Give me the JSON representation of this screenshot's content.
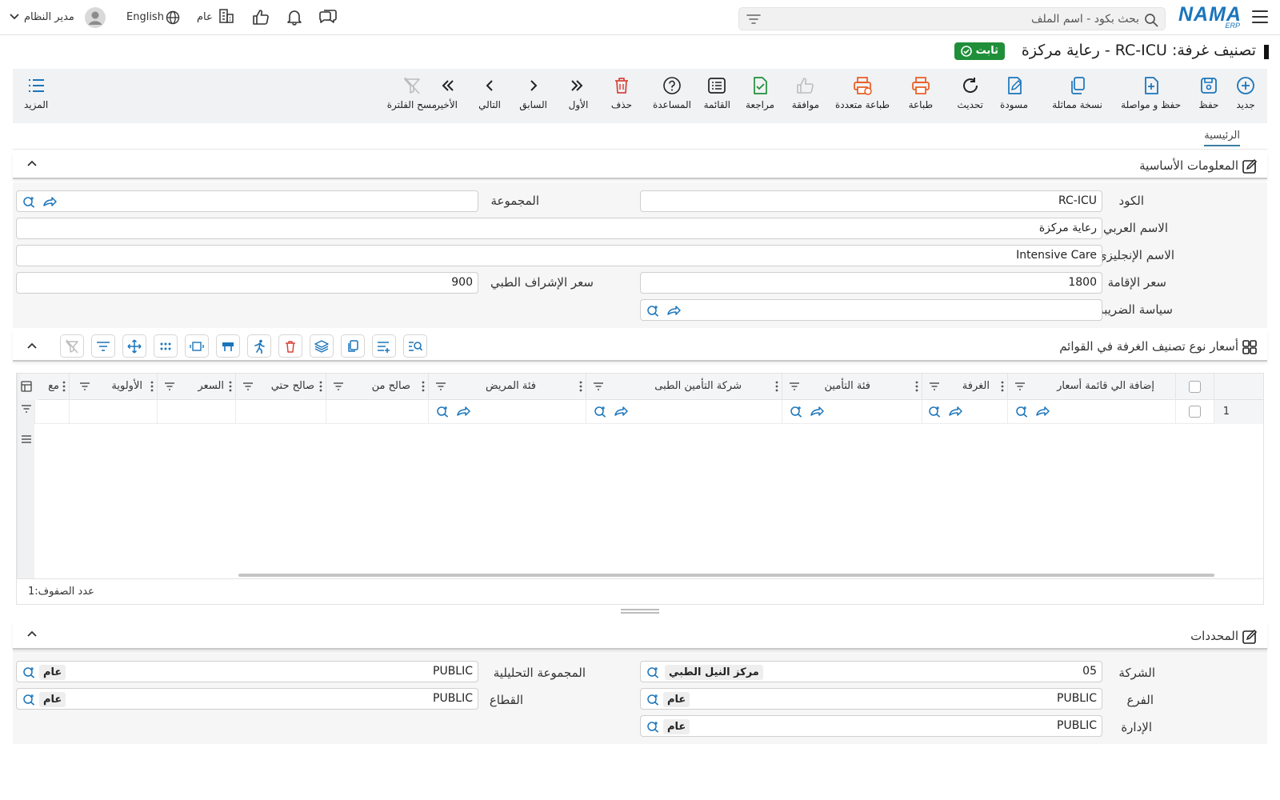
{
  "topbar": {
    "logo_main": "NAMA",
    "logo_sub": "ERP",
    "search_placeholder": "بحث بكود - اسم الملف",
    "org_label": "عام",
    "language_label": "English",
    "user_label": "مدير النظام"
  },
  "page": {
    "title": "تصنيف غرفة: RC-ICU - رعاية مركزة",
    "status_badge": "ثابت",
    "status_color": "#1f8f3a"
  },
  "toolbar": {
    "items": [
      {
        "label": "جديد",
        "icon": "plus-circle-icon"
      },
      {
        "label": "حفظ",
        "icon": "save-icon"
      },
      {
        "label": "حفظ و مواصلة",
        "icon": "save-continue-icon"
      },
      {
        "label": "نسخة مماثلة",
        "icon": "duplicate-icon"
      },
      {
        "label": "مسودة",
        "icon": "draft-icon"
      },
      {
        "label": "تحديث",
        "icon": "refresh-icon"
      },
      {
        "label": "طباعة",
        "icon": "print-icon"
      },
      {
        "label": "طباعة متعددة",
        "icon": "multi-print-icon"
      },
      {
        "label": "موافقة",
        "icon": "thumbs-up-icon"
      },
      {
        "label": "مراجعة",
        "icon": "review-icon"
      },
      {
        "label": "القائمة",
        "icon": "list-icon"
      },
      {
        "label": "المساعدة",
        "icon": "help-icon"
      },
      {
        "label": "حذف",
        "icon": "trash-icon"
      },
      {
        "label": "الأول",
        "icon": "first-icon"
      },
      {
        "label": "السابق",
        "icon": "previous-icon"
      },
      {
        "label": "التالي",
        "icon": "next-icon"
      },
      {
        "label": "الأخير",
        "icon": "last-icon"
      },
      {
        "label": "مسح الفلترة",
        "icon": "clear-filter-icon"
      }
    ],
    "more_label": "المزيد"
  },
  "tabs": {
    "main": "الرئيسية"
  },
  "basic_info": {
    "title": "المعلومات الأساسية",
    "code_label": "الكود",
    "code_value": "RC-ICU",
    "group_label": "المجموعة",
    "group_value": "",
    "arabic_name_label": "الاسم العربي",
    "arabic_name_value": "رعاية مركزة",
    "english_name_label": "الاسم الإنجليزي",
    "english_name_value": "Intensive Care",
    "stay_price_label": "سعر الإقامة",
    "stay_price_value": "1800",
    "supervision_price_label": "سعر الإشراف الطبي",
    "supervision_price_value": "900",
    "tax_policy_label": "سياسة الضريبة",
    "tax_policy_value": ""
  },
  "grid": {
    "title": "أسعار نوع تصنيف الغرفة في القوائم",
    "columns": [
      "إضافة الي قائمة أسعار",
      "الغرفة",
      "فئة التأمين",
      "شركة التأمين الطبى",
      "فئة المريض",
      "صالح من",
      "صالح حتي",
      "السعر",
      "الأولوية",
      "مع"
    ],
    "rows": [
      {
        "index": "1"
      }
    ],
    "row_count_label": "عدد الصفوف:",
    "row_count_value": "1"
  },
  "dimensions": {
    "title": "المحددات",
    "company_label": "الشركة",
    "company_code": "05",
    "company_name": "مركز النيل الطبي",
    "analytic_group_label": "المجموعة التحليلية",
    "analytic_group_code": "PUBLIC",
    "analytic_group_name": "عام",
    "branch_label": "الفرع",
    "branch_code": "PUBLIC",
    "branch_name": "عام",
    "sector_label": "القطاع",
    "sector_code": "PUBLIC",
    "sector_name": "عام",
    "department_label": "الإدارة",
    "department_code": "PUBLIC",
    "department_name": "عام"
  },
  "colors": {
    "accent": "#1a75bb",
    "danger": "#d9453b",
    "orange": "#ea5a1f",
    "green": "#1f8f3a"
  }
}
